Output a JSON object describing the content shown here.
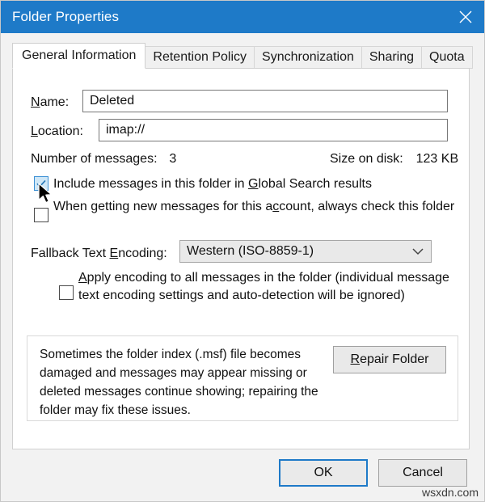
{
  "window": {
    "title": "Folder Properties",
    "close_icon": "close-icon",
    "titlebar_color": "#1e7ac8"
  },
  "tabs": [
    {
      "label": "General Information",
      "active": true
    },
    {
      "label": "Retention Policy",
      "active": false
    },
    {
      "label": "Synchronization",
      "active": false
    },
    {
      "label": "Sharing",
      "active": false
    },
    {
      "label": "Quota",
      "active": false
    }
  ],
  "general": {
    "name_label_pre": "N",
    "name_label_post": "ame:",
    "name_value": "Deleted",
    "location_label_pre": "L",
    "location_label_post": "ocation:",
    "location_value": "imap://",
    "messages_label": "Number of messages:",
    "messages_value": "3",
    "size_label": "Size on disk:",
    "size_value": "123 KB",
    "checkbox_global_search": {
      "checked": true,
      "text_pre": "Include messages in this folder in ",
      "text_accel": "G",
      "text_post": "lobal Search results"
    },
    "checkbox_check_folder": {
      "checked": false,
      "text_pre": "When getting new messages for this a",
      "text_accel": "c",
      "text_post": "count, always check this folder"
    },
    "encoding_label_pre": "Fallback Text ",
    "encoding_label_accel": "E",
    "encoding_label_post": "ncoding:",
    "encoding_value": "Western (ISO-8859-1)",
    "encoding_chevron_icon": "chevron-down-icon",
    "checkbox_apply_encoding": {
      "checked": false,
      "text_accel": "A",
      "text_post": "pply encoding to all messages in the folder (individual message text encoding settings and auto-detection will be ignored)"
    },
    "repair": {
      "description": "Sometimes the folder index (.msf) file becomes damaged and messages may appear missing or deleted messages continue showing; repairing the folder may fix these issues.",
      "button_accel": "R",
      "button_label_post": "epair Folder"
    }
  },
  "footer": {
    "ok_label": "OK",
    "cancel_label": "Cancel"
  },
  "watermark": "wsxdn.com",
  "cursor": {
    "icon": "mouse-pointer-icon"
  }
}
